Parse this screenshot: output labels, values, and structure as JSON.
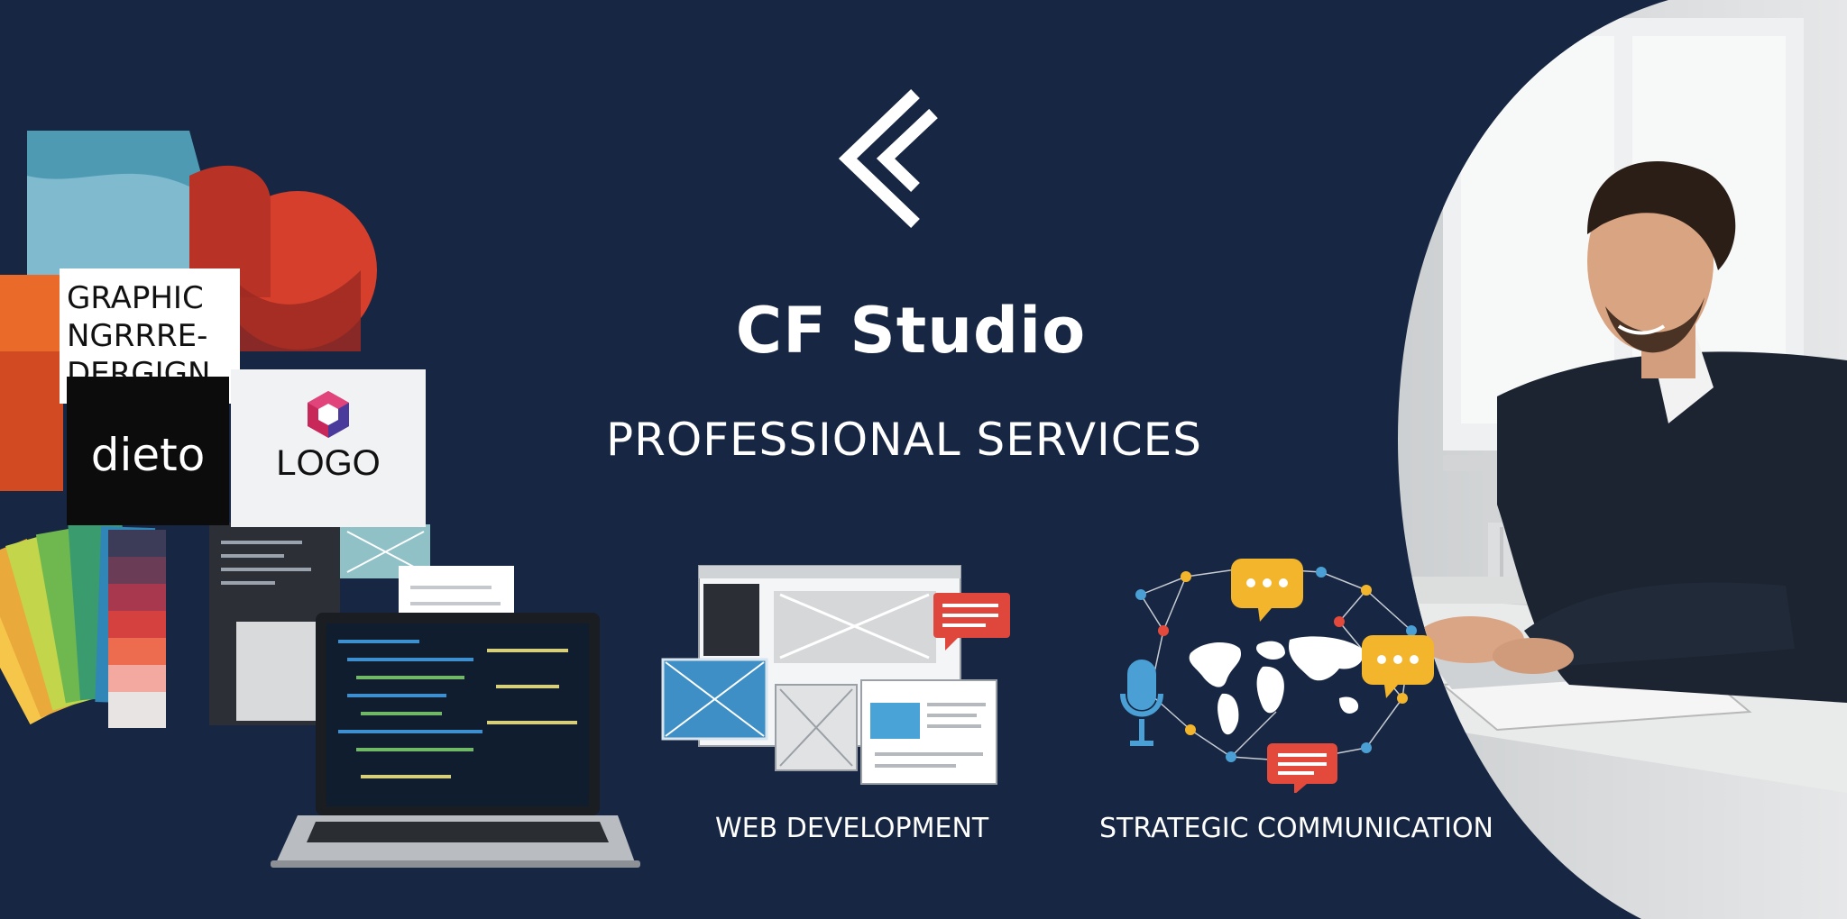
{
  "brand": {
    "name": "CF Studio",
    "tagline": "PROFESSIONAL SERVICES",
    "logo_icon": "chevron-mark-icon"
  },
  "collage": {
    "graphic_design_lines": [
      "GRAPHIC",
      "NGRRRE-",
      "DERGIGN"
    ],
    "dieto_label": "dieto",
    "logo_label": "LOGO"
  },
  "services": [
    {
      "label": "WEB DEVELOPMENT",
      "icon": "browser-wireframes-icon"
    },
    {
      "label": "STRATEGIC COMMUNICATION",
      "icon": "world-network-icon"
    }
  ],
  "colors": {
    "background": "#172642",
    "text": "#ffffff",
    "accent_red": "#e44a3b",
    "accent_yellow": "#f3b52b",
    "accent_blue": "#4a9fd4"
  }
}
